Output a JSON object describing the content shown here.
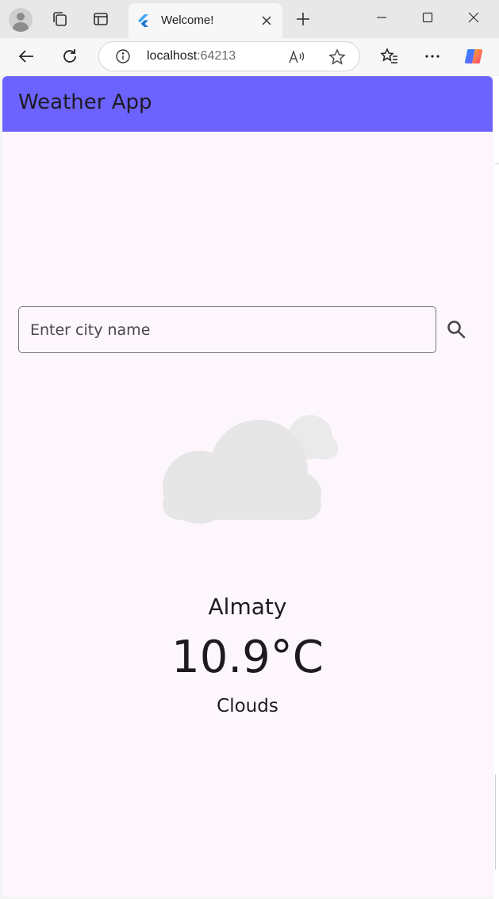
{
  "browser": {
    "tab_title": "Welcome!",
    "url_host": "localhost",
    "url_port": ":64213",
    "read_aloud_label": "A)"
  },
  "app": {
    "title": "Weather App",
    "search": {
      "placeholder": "Enter city name",
      "value": ""
    },
    "weather": {
      "city": "Almaty",
      "temperature": "10.9°C",
      "description": "Clouds",
      "icon": "cloud-icon"
    }
  },
  "colors": {
    "app_bar": "#6c63ff",
    "background": "#fdf7fd",
    "text": "#1d1b20",
    "field_border": "#79747e",
    "cloud": "#e6e6e6"
  }
}
